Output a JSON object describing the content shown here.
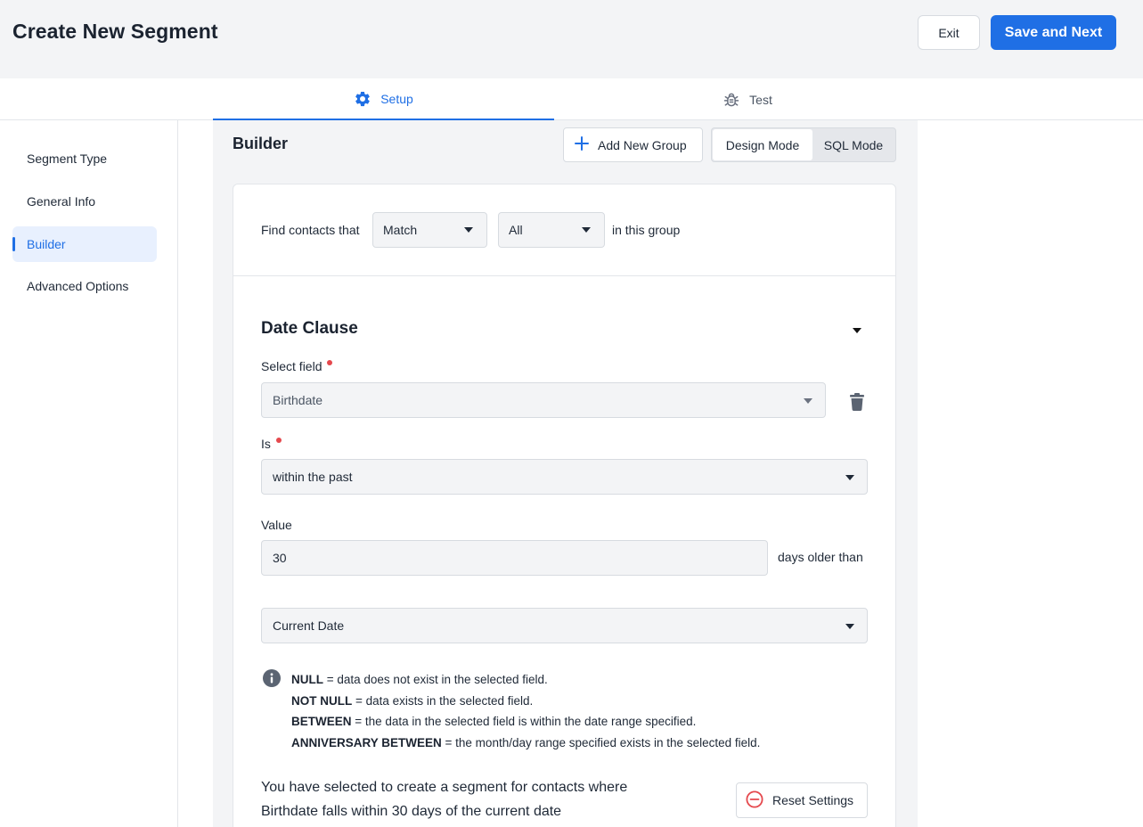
{
  "header": {
    "title": "Create New Segment",
    "exit_label": "Exit",
    "save_label": "Save and Next",
    "accent_color": "#1f6fe5"
  },
  "tabs": [
    {
      "label": "Setup",
      "icon": "gear-icon",
      "active": true
    },
    {
      "label": "Test",
      "icon": "bug-icon",
      "active": false
    }
  ],
  "sidebar": {
    "items": [
      {
        "label": "Segment Type",
        "active": false
      },
      {
        "label": "General Info",
        "active": false
      },
      {
        "label": "Builder",
        "active": true
      },
      {
        "label": "Advanced Options",
        "active": false
      }
    ]
  },
  "builder": {
    "title": "Builder",
    "add_group_label": "Add New Group",
    "modes": [
      "Design Mode",
      "SQL Mode"
    ],
    "active_mode": "Design Mode"
  },
  "group": {
    "find_label": "Find contacts that",
    "match_value": "Match",
    "quantifier_value": "All",
    "suffix_label": "in this group"
  },
  "clause": {
    "title": "Date Clause",
    "select_field_label": "Select field",
    "select_field_value": "Birthdate",
    "is_label": "Is",
    "is_value": "within the past",
    "value_label": "Value",
    "value": "30",
    "days_label": "days older than",
    "reference_value": "Current Date"
  },
  "info": [
    {
      "term": "NULL",
      "text": " = data does not exist in the selected field."
    },
    {
      "term": "NOT NULL",
      "text": " = data exists in the selected field."
    },
    {
      "term": "BETWEEN",
      "text": " = the data in the selected field is within the date range specified."
    },
    {
      "term": "ANNIVERSARY BETWEEN",
      "text": " = the month/day range specified exists in the selected field."
    }
  ],
  "summary": {
    "line1": "You have selected to create a segment for contacts where",
    "line2": "Birthdate falls within 30 days of the current date"
  },
  "reset_label": "Reset Settings"
}
